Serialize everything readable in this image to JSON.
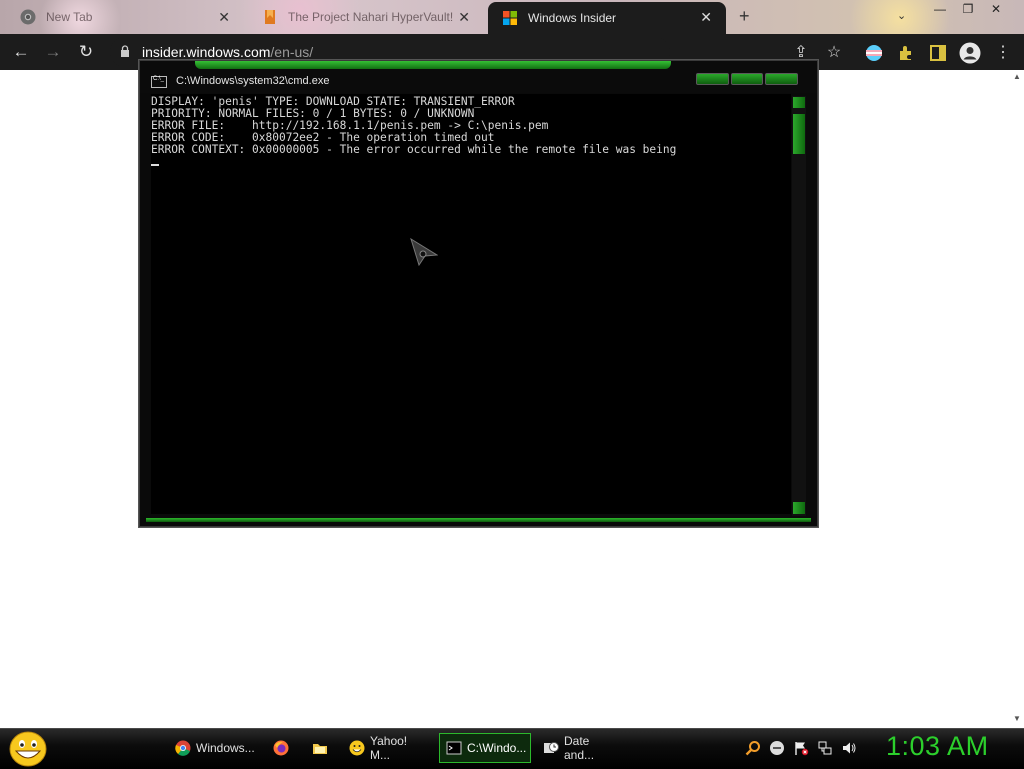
{
  "browser": {
    "tabs": [
      {
        "label": "New Tab",
        "favicon": "chrome-icon",
        "active": false
      },
      {
        "label": "The Project Nahari HyperVault!",
        "favicon": "bookmark-icon",
        "active": false
      },
      {
        "label": "Windows Insider",
        "favicon": "windows-logo-icon",
        "active": true
      }
    ],
    "new_tab_glyph": "+",
    "url_host": "insider.windows.com",
    "url_path": "/en-us/"
  },
  "cmd": {
    "title": "C:\\Windows\\system32\\cmd.exe",
    "lines": [
      "DISPLAY: 'penis' TYPE: DOWNLOAD STATE: TRANSIENT_ERROR",
      "PRIORITY: NORMAL FILES: 0 / 1 BYTES: 0 / UNKNOWN",
      "ERROR FILE:    http://192.168.1.1/penis.pem -> C:\\penis.pem",
      "ERROR CODE:    0x80072ee2 - The operation timed out",
      "ERROR CONTEXT: 0x00000005 - The error occurred while the remote file was being"
    ]
  },
  "taskbar": {
    "buttons": [
      {
        "label": "Windows...",
        "icon": "chrome-icon",
        "active": false
      },
      {
        "label": "",
        "icon": "firefox-icon",
        "active": false
      },
      {
        "label": "",
        "icon": "folder-icon",
        "active": false
      },
      {
        "label": "Yahoo! M...",
        "icon": "yahoo-messenger-icon",
        "active": false
      },
      {
        "label": "C:\\Windo...",
        "icon": "cmd-icon",
        "active": true
      },
      {
        "label": "Date and...",
        "icon": "date-time-icon",
        "active": false
      }
    ],
    "clock": "1:03 AM"
  },
  "colors": {
    "accent_green": "#2cb82c",
    "clock_green": "#2ccf2c",
    "toolbar_bg": "#1c1c1c"
  }
}
